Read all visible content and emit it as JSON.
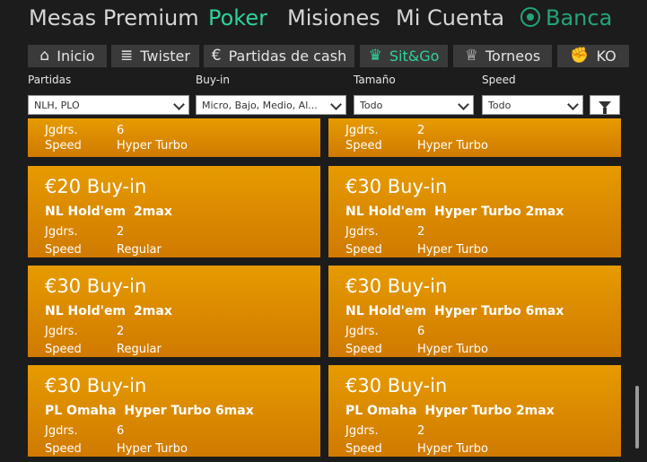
{
  "topnav": {
    "mesas": "Mesas Premium",
    "poker": "Poker",
    "misiones": "Misiones",
    "cuenta": "Mi Cuenta",
    "banca": "Banca"
  },
  "subtabs": [
    {
      "label": "Inicio",
      "icon": "home-icon"
    },
    {
      "label": "Twister",
      "icon": "twister-icon"
    },
    {
      "label": "Partidas de cash",
      "icon": "euro-icon"
    },
    {
      "label": "Sit&Go",
      "icon": "trophy-icon"
    },
    {
      "label": "Torneos",
      "icon": "cup-icon"
    },
    {
      "label": "KO",
      "icon": "fist-icon"
    }
  ],
  "filters": {
    "partidas": {
      "label": "Partidas",
      "value": "NLH, PLO"
    },
    "buyin": {
      "label": "Buy-in",
      "value": "Micro, Bajo, Medio, Al..."
    },
    "tamano": {
      "label": "Tamaño",
      "value": "Todo"
    },
    "speed": {
      "label": "Speed",
      "value": "Todo"
    }
  },
  "labels": {
    "players": "Jgdrs.",
    "speed": "Speed"
  },
  "partial_cards": [
    {
      "players": "6",
      "speed": "Hyper Turbo"
    },
    {
      "players": "2",
      "speed": "Hyper Turbo"
    }
  ],
  "cards": [
    {
      "buyin": "€20 Buy-in",
      "game": "NL Hold'em",
      "format": "2max",
      "players": "2",
      "speed": "Regular"
    },
    {
      "buyin": "€30 Buy-in",
      "game": "NL Hold'em",
      "format": "Hyper Turbo 2max",
      "players": "2",
      "speed": "Hyper Turbo"
    },
    {
      "buyin": "€30 Buy-in",
      "game": "NL Hold'em",
      "format": "2max",
      "players": "2",
      "speed": "Regular"
    },
    {
      "buyin": "€30 Buy-in",
      "game": "NL Hold'em",
      "format": "Hyper Turbo 6max",
      "players": "6",
      "speed": "Hyper Turbo"
    },
    {
      "buyin": "€30 Buy-in",
      "game": "PL Omaha",
      "format": "Hyper Turbo 6max",
      "players": "6",
      "speed": "Hyper Turbo"
    },
    {
      "buyin": "€30 Buy-in",
      "game": "PL Omaha",
      "format": "Hyper Turbo 2max",
      "players": "2",
      "speed": "Hyper Turbo"
    }
  ]
}
